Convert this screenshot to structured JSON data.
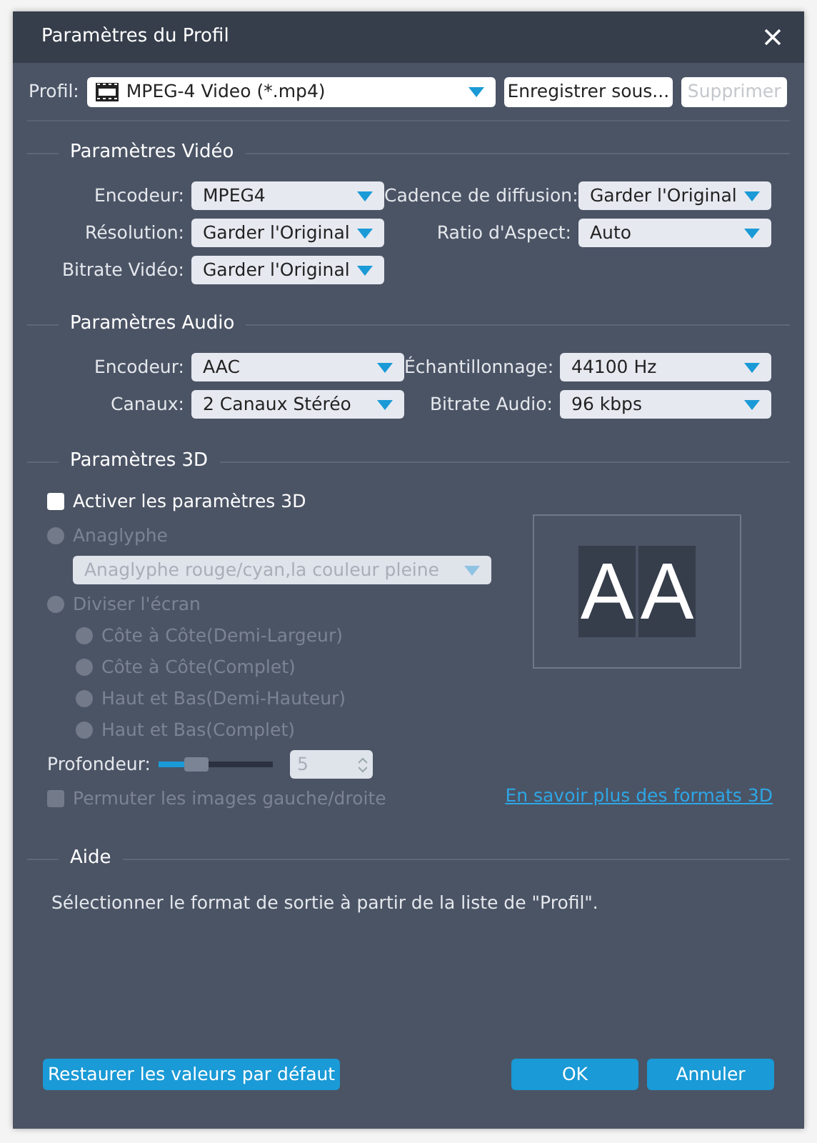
{
  "window": {
    "title": "Paramètres du Profil"
  },
  "profile": {
    "label": "Profil:",
    "value": "MPEG-4 Video (*.mp4)"
  },
  "profile_buttons": [
    {
      "label": "Enregistrer sous...",
      "disabled": false
    },
    {
      "label": "Supprimer",
      "disabled": true
    }
  ],
  "video": {
    "title": "Paramètres Vidéo",
    "left": [
      {
        "label": "Encodeur:",
        "value": "MPEG4"
      },
      {
        "label": "Résolution:",
        "value": "Garder l'Original"
      },
      {
        "label": "Bitrate Vidéo:",
        "value": "Garder l'Original"
      }
    ],
    "right": [
      {
        "label": "Cadence de diffusion:",
        "value": "Garder l'Original"
      },
      {
        "label": "Ratio d'Aspect:",
        "value": "Auto"
      }
    ]
  },
  "audio": {
    "title": "Paramètres Audio",
    "left": [
      {
        "label": "Encodeur:",
        "value": "AAC"
      },
      {
        "label": "Canaux:",
        "value": "2 Canaux Stéréo"
      }
    ],
    "right": [
      {
        "label": "Échantillonnage:",
        "value": "44100 Hz"
      },
      {
        "label": "Bitrate Audio:",
        "value": "96 kbps"
      }
    ]
  },
  "three_d": {
    "title": "Paramètres 3D",
    "enable": {
      "label": "Activer les paramètres 3D",
      "checked": false
    },
    "anaglyph": {
      "label": "Anaglyphe",
      "selected": false,
      "disabled": true
    },
    "anaglyph_mode": {
      "value": "Anaglyphe rouge/cyan,la couleur pleine",
      "disabled": true
    },
    "split": {
      "label": "Diviser l'écran",
      "selected": false,
      "disabled": true
    },
    "split_modes": [
      {
        "label": "Côte à Côte(Demi-Largeur)",
        "selected": false,
        "disabled": true
      },
      {
        "label": "Côte à Côte(Complet)",
        "selected": false,
        "disabled": true
      },
      {
        "label": "Haut et Bas(Demi-Hauteur)",
        "selected": false,
        "disabled": true
      },
      {
        "label": "Haut et Bas(Complet)",
        "selected": false,
        "disabled": true
      }
    ],
    "depth": {
      "label": "Profondeur:",
      "level": 0.33,
      "value": "5",
      "disabled": true
    },
    "swap": {
      "label": "Permuter les images gauche/droite",
      "checked": false,
      "disabled": true
    },
    "preview": [
      "A",
      "A"
    ],
    "link": "En savoir plus des formats 3D"
  },
  "help": {
    "title": "Aide",
    "text": "Sélectionner le format de sortie à partir de la liste de \"Profil\"."
  },
  "footer": {
    "restore": "Restaurer les valeurs par défaut",
    "ok": "OK",
    "cancel": "Annuler"
  }
}
